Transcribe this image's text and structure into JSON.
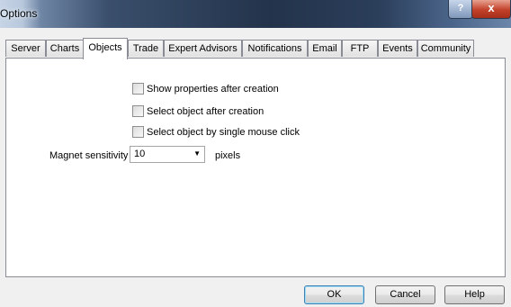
{
  "window": {
    "title": "Options",
    "help_label": "?",
    "close_label": "x"
  },
  "tabs": [
    {
      "label": "Server"
    },
    {
      "label": "Charts"
    },
    {
      "label": "Objects",
      "active": true
    },
    {
      "label": "Trade"
    },
    {
      "label": "Expert Advisors"
    },
    {
      "label": "Notifications"
    },
    {
      "label": "Email"
    },
    {
      "label": "FTP"
    },
    {
      "label": "Events"
    },
    {
      "label": "Community"
    }
  ],
  "objects": {
    "show_properties": {
      "label": "Show properties after creation",
      "checked": false
    },
    "select_object": {
      "label": "Select object after creation",
      "checked": false
    },
    "single_click": {
      "label": "Select object by single mouse click",
      "checked": false
    },
    "magnet": {
      "label": "Magnet sensitivity",
      "value": "10",
      "unit": "pixels"
    }
  },
  "footer": {
    "ok_label": "OK",
    "cancel_label": "Cancel",
    "help_label": "Help"
  }
}
